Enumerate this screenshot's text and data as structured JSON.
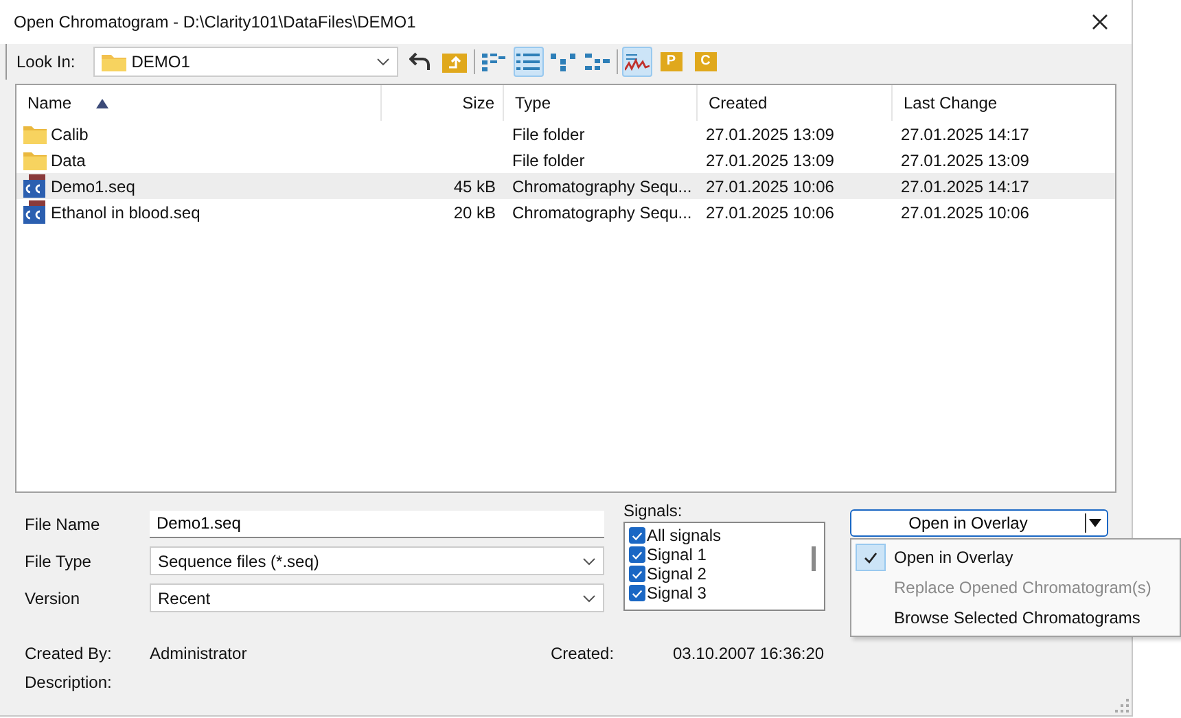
{
  "window": {
    "title": "Open Chromatogram - D:\\Clarity101\\DataFiles\\DEMO1"
  },
  "look_in": {
    "label": "Look In:",
    "value": "DEMO1"
  },
  "toolbar": [
    {
      "kind": "back",
      "selected": false
    },
    {
      "kind": "up-folder",
      "selected": false
    },
    {
      "kind": "list-view",
      "selected": false
    },
    {
      "kind": "details-view",
      "selected": true
    },
    {
      "kind": "tree-view",
      "selected": false
    },
    {
      "kind": "branch-view",
      "selected": false
    },
    {
      "kind": "chromatogram",
      "selected": true
    },
    {
      "kind": "letter",
      "label": "P",
      "selected": false
    },
    {
      "kind": "letter",
      "label": "C",
      "selected": false
    }
  ],
  "table": {
    "columns": [
      {
        "label": "Name",
        "sorted": true
      },
      {
        "label": "Size",
        "sorted": false
      },
      {
        "label": "Type",
        "sorted": false
      },
      {
        "label": "Created",
        "sorted": false
      },
      {
        "label": "Last Change",
        "sorted": false
      }
    ],
    "rows": [
      {
        "kind": "folder",
        "name": "Calib",
        "size": "",
        "type": "File folder",
        "created": "27.01.2025 13:09",
        "last_change": "27.01.2025 14:17",
        "selected": false
      },
      {
        "kind": "folder",
        "name": "Data",
        "size": "",
        "type": "File folder",
        "created": "27.01.2025 13:09",
        "last_change": "27.01.2025 13:09",
        "selected": false
      },
      {
        "kind": "sequence",
        "name": "Demo1.seq",
        "size": "45 kB",
        "type": "Chromatography Sequ...",
        "created": "27.01.2025 10:06",
        "last_change": "27.01.2025 14:17",
        "selected": true
      },
      {
        "kind": "sequence",
        "name": "Ethanol in blood.seq",
        "size": "20 kB",
        "type": "Chromatography Sequ...",
        "created": "27.01.2025 10:06",
        "last_change": "27.01.2025 10:06",
        "selected": false
      }
    ]
  },
  "file_name": {
    "label": "File Name",
    "value": "Demo1.seq"
  },
  "file_type": {
    "label": "File Type",
    "value": "Sequence files (*.seq)"
  },
  "version": {
    "label": "Version",
    "value": "Recent"
  },
  "signals": {
    "label": "Signals:",
    "items": [
      {
        "label": "All signals",
        "checked": true
      },
      {
        "label": "Signal 1",
        "checked": true
      },
      {
        "label": "Signal 2",
        "checked": true
      },
      {
        "label": "Signal 3",
        "checked": true
      }
    ]
  },
  "open_button": {
    "label": "Open in Overlay"
  },
  "open_menu": [
    {
      "label": "Open in Overlay",
      "checked": true,
      "disabled": false
    },
    {
      "label": "Replace Opened Chromatogram(s)",
      "checked": false,
      "disabled": true
    },
    {
      "label": "Browse Selected Chromatograms",
      "checked": false,
      "disabled": false
    }
  ],
  "info": {
    "created_by_label": "Created By:",
    "created_by": "Administrator",
    "created_label": "Created:",
    "created": "03.10.2007 16:36:20",
    "description_label": "Description:"
  }
}
